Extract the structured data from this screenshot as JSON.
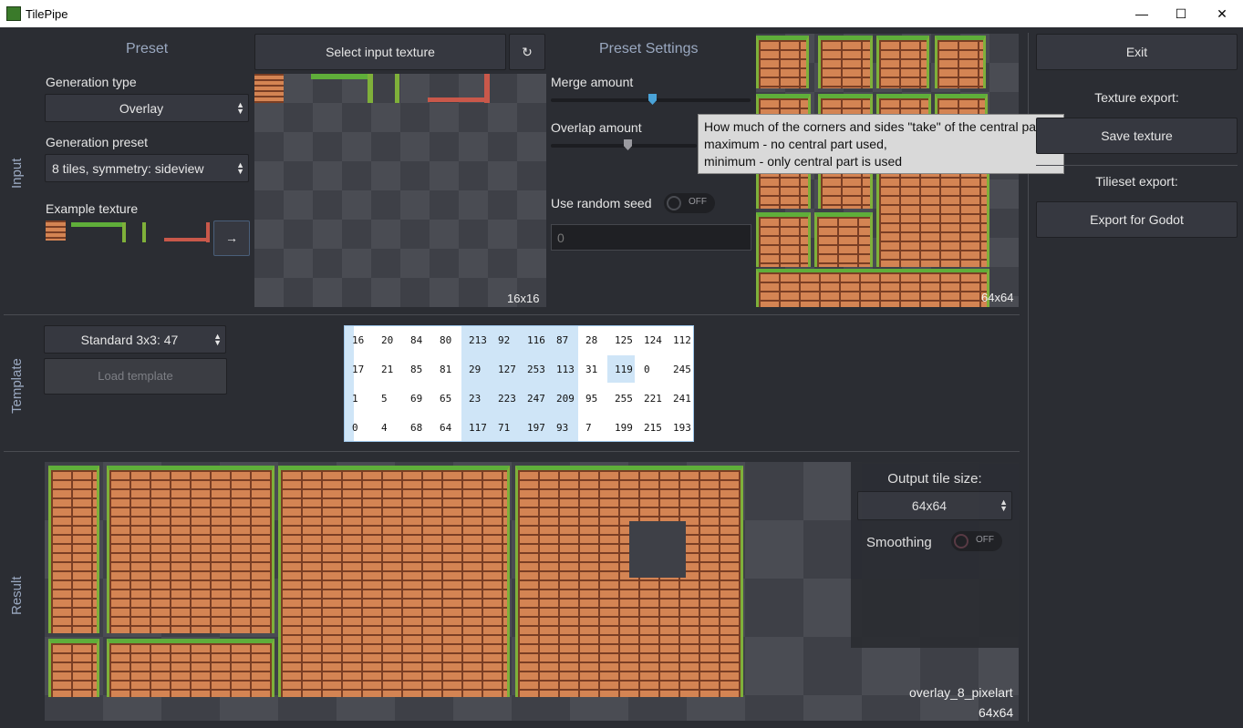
{
  "window": {
    "title": "TilePipe",
    "minimize": "—",
    "maximize": "☐",
    "close": "✕"
  },
  "sections": {
    "input": "Input",
    "template": "Template",
    "result": "Result"
  },
  "preset": {
    "header": "Preset",
    "generation_type_label": "Generation type",
    "generation_type_value": "Overlay",
    "generation_preset_label": "Generation preset",
    "generation_preset_value": "8 tiles, symmetry: sideview",
    "example_texture_label": "Example texture",
    "apply_example_button": "→"
  },
  "input_texture": {
    "select_button": "Select input texture",
    "reload_button": "↻",
    "size_label": "16x16"
  },
  "preset_settings": {
    "header": "Preset Settings",
    "merge_label": "Merge amount",
    "merge_value": 0.55,
    "overlap_label": "Overlap amount",
    "overlap_value": 0.4,
    "random_seed_label": "Use random seed",
    "random_seed_toggle": "OFF",
    "seed_value": "0"
  },
  "tooltip": {
    "line1": "How much of the corners and sides \"take\" of  the central part:",
    "line2": "maximum - no central part used,",
    "line3": "minimum - only central part is used"
  },
  "preview": {
    "size_label": "64x64"
  },
  "right_panel": {
    "exit_button": "Exit",
    "texture_export_label": "Texture export:",
    "save_texture_button": "Save texture",
    "tileset_export_label": "Tilieset export:",
    "export_godot_button": "Export for Godot"
  },
  "template": {
    "select_value": "Standard 3x3: 47",
    "load_button": "Load template",
    "grid": [
      [
        "16",
        "20",
        "84",
        "80",
        "213",
        "92",
        "116",
        "87",
        "28",
        "125",
        "124",
        "112"
      ],
      [
        "17",
        "21",
        "85",
        "81",
        "29",
        "127",
        "253",
        "113",
        "31",
        "119",
        "0",
        "245"
      ],
      [
        "1",
        "5",
        "69",
        "65",
        "23",
        "223",
        "247",
        "209",
        "95",
        "255",
        "221",
        "241"
      ],
      [
        "0",
        "4",
        "68",
        "64",
        "117",
        "71",
        "197",
        "93",
        "7",
        "199",
        "215",
        "193"
      ]
    ]
  },
  "result": {
    "output_tile_size_label": "Output tile size:",
    "output_tile_size_value": "64x64",
    "smoothing_label": "Smoothing",
    "smoothing_toggle": "OFF",
    "name_label": "overlay_8_pixelart",
    "size_label": "64x64"
  },
  "colors": {
    "accent": "#4aa3d8",
    "panel": "#2b2d33",
    "header": "#9aa8c0",
    "grass": "#5fae3a",
    "brick": "#d48453"
  }
}
